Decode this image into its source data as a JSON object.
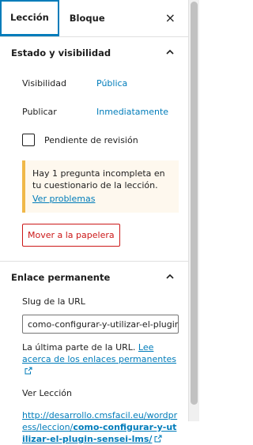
{
  "tabs": [
    {
      "label": "Lección"
    },
    {
      "label": "Bloque"
    }
  ],
  "close_label": "×",
  "status_section": {
    "title": "Estado y visibilidad",
    "visibility_label": "Visibilidad",
    "visibility_value": "Pública",
    "publish_label": "Publicar",
    "publish_value": "Inmediatamente",
    "pending_label": "Pendiente de revisión",
    "notice_text": "Hay 1 pregunta incompleta en tu cuestionario de la lección.",
    "notice_link": "Ver problemas",
    "trash_label": "Mover a la papelera"
  },
  "permalink_section": {
    "title": "Enlace permanente",
    "slug_label": "Slug de la URL",
    "slug_value": "como-configurar-y-utilizar-el-plugin-sen",
    "help_text": "La última parte de la URL.",
    "help_link": "Lee acerca de los enlaces permanentes",
    "view_label": "Ver Lección",
    "url_prefix": "http://desarrollo.cmsfacil.eu/wordpress/leccion/",
    "url_slug": "como-configurar-y-utilizar-el-plugin-sensei-lms/"
  },
  "colors": {
    "accent": "#007cba",
    "danger": "#cc1818",
    "notice_border": "#f0b849",
    "notice_bg": "#fef8ee"
  }
}
